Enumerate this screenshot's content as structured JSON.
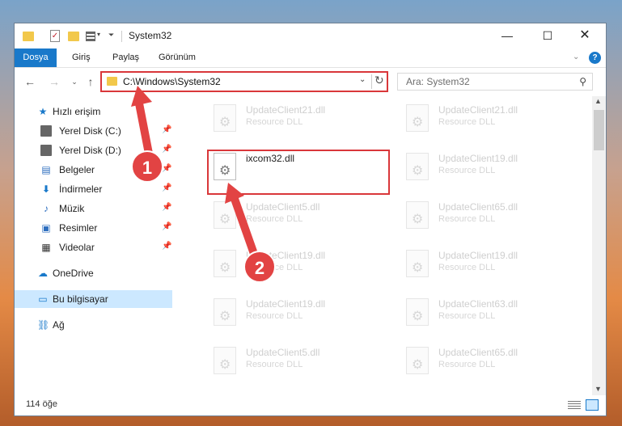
{
  "window": {
    "title": "System32",
    "controls": {
      "minimize": "—",
      "maximize": "☐",
      "close": "✕"
    }
  },
  "quick_access_toolbar": {
    "check_glyph": "✓",
    "arrow_glyph": "▾",
    "down_glyph": "⏷"
  },
  "ribbon": {
    "file_tab": "Dosya",
    "tabs": [
      "Giriş",
      "Paylaş",
      "Görünüm"
    ],
    "collapse_glyph": "⌄",
    "help_glyph": "?"
  },
  "navigation": {
    "back_glyph": "←",
    "forward_glyph": "→",
    "history_glyph": "⌄",
    "up_glyph": "↑",
    "address_path": "C:\\Windows\\System32",
    "address_dropdown_glyph": "⌄",
    "refresh_glyph": "↻",
    "search_placeholder": "Ara: System32",
    "search_glyph": "⚲"
  },
  "sidebar": {
    "pin_glyph": "📌",
    "quick_access": {
      "label": "Hızlı erişim",
      "icon": "star-icon",
      "glyph": "★"
    },
    "pinned": [
      {
        "label": "Yerel Disk (C:)",
        "icon": "drive-icon",
        "glyph": ""
      },
      {
        "label": "Yerel Disk (D:)",
        "icon": "drive-icon",
        "glyph": ""
      },
      {
        "label": "Belgeler",
        "icon": "document-icon",
        "glyph": "▤"
      },
      {
        "label": "İndirmeler",
        "icon": "download-icon",
        "glyph": "⬇"
      },
      {
        "label": "Müzik",
        "icon": "music-icon",
        "glyph": "♪"
      },
      {
        "label": "Resimler",
        "icon": "pictures-icon",
        "glyph": "▣"
      },
      {
        "label": "Videolar",
        "icon": "video-icon",
        "glyph": "▦"
      }
    ],
    "onedrive": {
      "label": "OneDrive",
      "icon": "cloud-icon",
      "glyph": "☁"
    },
    "this_pc": {
      "label": "Bu bilgisayar",
      "icon": "computer-icon",
      "glyph": "▭"
    },
    "network": {
      "label": "Ağ",
      "icon": "network-icon",
      "glyph": "⛓"
    }
  },
  "files": [
    {
      "name": "UpdateClient21.dll",
      "desc": "Resource DLL"
    },
    {
      "name": "UpdateClient21.dll",
      "desc": "Resource DLL"
    },
    {
      "name": "ixcom32.dll",
      "desc": ""
    },
    {
      "name": "UpdateClient19.dll",
      "desc": "Resource DLL"
    },
    {
      "name": "UpdateClient5.dll",
      "desc": "Resource DLL"
    },
    {
      "name": "UpdateClient65.dll",
      "desc": "Resource DLL"
    },
    {
      "name": "UpdateClient19.dll",
      "desc": "Resource DLL"
    },
    {
      "name": "UpdateClient19.dll",
      "desc": "Resource DLL"
    },
    {
      "name": "UpdateClient19.dll",
      "desc": "Resource DLL"
    },
    {
      "name": "UpdateClient63.dll",
      "desc": "Resource DLL"
    },
    {
      "name": "UpdateClient5.dll",
      "desc": "Resource DLL"
    },
    {
      "name": "UpdateClient65.dll",
      "desc": "Resource DLL"
    }
  ],
  "scrollbar": {
    "up_glyph": "▲",
    "down_glyph": "▼"
  },
  "status": {
    "item_count": "114 öğe"
  },
  "annotations": {
    "step1": "1",
    "step2": "2",
    "color": "#e24343",
    "highlight_color": "#d9373a"
  }
}
